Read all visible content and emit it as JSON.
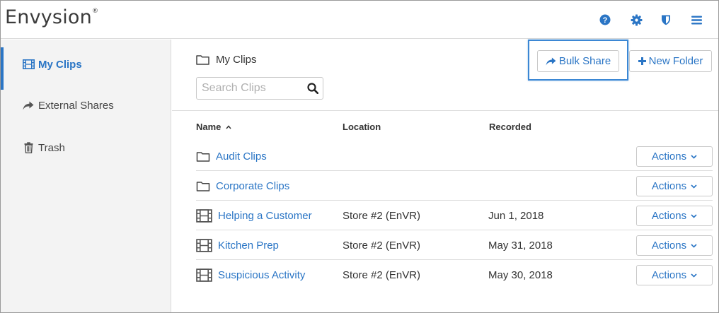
{
  "app": {
    "brand": "Envysion",
    "trademark": "®"
  },
  "header_icons": [
    {
      "name": "help-icon"
    },
    {
      "name": "gear-icon"
    },
    {
      "name": "shield-icon"
    },
    {
      "name": "hamburger-menu-icon"
    }
  ],
  "sidebar": {
    "items": [
      {
        "label": "My Clips",
        "icon": "film-icon",
        "active": true
      },
      {
        "label": "External Shares",
        "icon": "share-arrow-icon",
        "active": false
      },
      {
        "label": "Trash",
        "icon": "trash-icon",
        "active": false
      }
    ]
  },
  "main": {
    "breadcrumb": "My Clips",
    "search": {
      "placeholder": "Search Clips",
      "value": ""
    },
    "buttons": {
      "bulk_share": "Bulk Share",
      "new_folder": "New Folder"
    },
    "table": {
      "columns": {
        "name": "Name",
        "location": "Location",
        "recorded": "Recorded"
      },
      "sort_indicator": "^",
      "rows": [
        {
          "type": "folder",
          "name": "Audit Clips",
          "location": "",
          "recorded": "",
          "action": "Actions"
        },
        {
          "type": "folder",
          "name": "Corporate Clips",
          "location": "",
          "recorded": "",
          "action": "Actions"
        },
        {
          "type": "clip",
          "name": "Helping a Customer",
          "location": "Store #2 (EnVR)",
          "recorded": "Jun 1, 2018",
          "action": "Actions"
        },
        {
          "type": "clip",
          "name": "Kitchen Prep",
          "location": "Store #2 (EnVR)",
          "recorded": "May 31, 2018",
          "action": "Actions"
        },
        {
          "type": "clip",
          "name": "Suspicious Activity",
          "location": "Store #2 (EnVR)",
          "recorded": "May 30, 2018",
          "action": "Actions"
        }
      ]
    }
  },
  "colors": {
    "accent": "#2a75c5",
    "sidebar_bg": "#f3f3f3",
    "border": "#dcdcdc",
    "highlight": "#3b87d4"
  }
}
